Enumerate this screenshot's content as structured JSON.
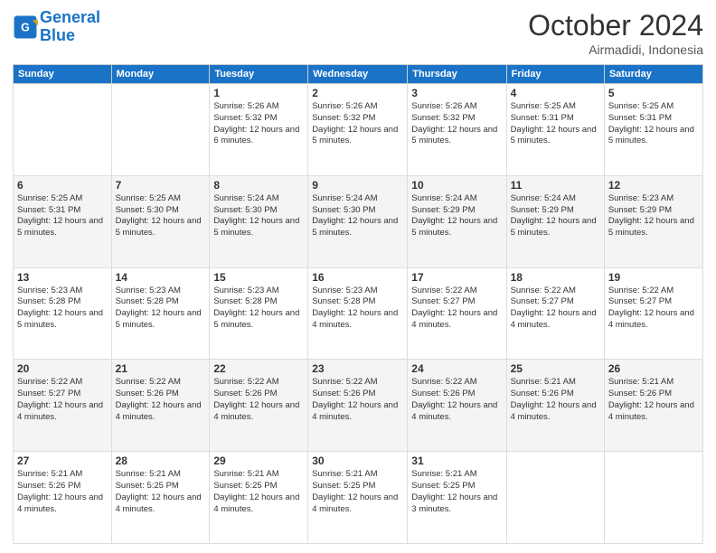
{
  "header": {
    "logo_line1": "General",
    "logo_line2": "Blue",
    "month": "October 2024",
    "location": "Airmadidi, Indonesia"
  },
  "weekdays": [
    "Sunday",
    "Monday",
    "Tuesday",
    "Wednesday",
    "Thursday",
    "Friday",
    "Saturday"
  ],
  "weeks": [
    [
      null,
      null,
      {
        "day": 1,
        "sunrise": "5:26 AM",
        "sunset": "5:32 PM",
        "daylight": "12 hours and 6 minutes."
      },
      {
        "day": 2,
        "sunrise": "5:26 AM",
        "sunset": "5:32 PM",
        "daylight": "12 hours and 5 minutes."
      },
      {
        "day": 3,
        "sunrise": "5:26 AM",
        "sunset": "5:32 PM",
        "daylight": "12 hours and 5 minutes."
      },
      {
        "day": 4,
        "sunrise": "5:25 AM",
        "sunset": "5:31 PM",
        "daylight": "12 hours and 5 minutes."
      },
      {
        "day": 5,
        "sunrise": "5:25 AM",
        "sunset": "5:31 PM",
        "daylight": "12 hours and 5 minutes."
      }
    ],
    [
      {
        "day": 6,
        "sunrise": "5:25 AM",
        "sunset": "5:31 PM",
        "daylight": "12 hours and 5 minutes."
      },
      {
        "day": 7,
        "sunrise": "5:25 AM",
        "sunset": "5:30 PM",
        "daylight": "12 hours and 5 minutes."
      },
      {
        "day": 8,
        "sunrise": "5:24 AM",
        "sunset": "5:30 PM",
        "daylight": "12 hours and 5 minutes."
      },
      {
        "day": 9,
        "sunrise": "5:24 AM",
        "sunset": "5:30 PM",
        "daylight": "12 hours and 5 minutes."
      },
      {
        "day": 10,
        "sunrise": "5:24 AM",
        "sunset": "5:29 PM",
        "daylight": "12 hours and 5 minutes."
      },
      {
        "day": 11,
        "sunrise": "5:24 AM",
        "sunset": "5:29 PM",
        "daylight": "12 hours and 5 minutes."
      },
      {
        "day": 12,
        "sunrise": "5:23 AM",
        "sunset": "5:29 PM",
        "daylight": "12 hours and 5 minutes."
      }
    ],
    [
      {
        "day": 13,
        "sunrise": "5:23 AM",
        "sunset": "5:28 PM",
        "daylight": "12 hours and 5 minutes."
      },
      {
        "day": 14,
        "sunrise": "5:23 AM",
        "sunset": "5:28 PM",
        "daylight": "12 hours and 5 minutes."
      },
      {
        "day": 15,
        "sunrise": "5:23 AM",
        "sunset": "5:28 PM",
        "daylight": "12 hours and 5 minutes."
      },
      {
        "day": 16,
        "sunrise": "5:23 AM",
        "sunset": "5:28 PM",
        "daylight": "12 hours and 4 minutes."
      },
      {
        "day": 17,
        "sunrise": "5:22 AM",
        "sunset": "5:27 PM",
        "daylight": "12 hours and 4 minutes."
      },
      {
        "day": 18,
        "sunrise": "5:22 AM",
        "sunset": "5:27 PM",
        "daylight": "12 hours and 4 minutes."
      },
      {
        "day": 19,
        "sunrise": "5:22 AM",
        "sunset": "5:27 PM",
        "daylight": "12 hours and 4 minutes."
      }
    ],
    [
      {
        "day": 20,
        "sunrise": "5:22 AM",
        "sunset": "5:27 PM",
        "daylight": "12 hours and 4 minutes."
      },
      {
        "day": 21,
        "sunrise": "5:22 AM",
        "sunset": "5:26 PM",
        "daylight": "12 hours and 4 minutes."
      },
      {
        "day": 22,
        "sunrise": "5:22 AM",
        "sunset": "5:26 PM",
        "daylight": "12 hours and 4 minutes."
      },
      {
        "day": 23,
        "sunrise": "5:22 AM",
        "sunset": "5:26 PM",
        "daylight": "12 hours and 4 minutes."
      },
      {
        "day": 24,
        "sunrise": "5:22 AM",
        "sunset": "5:26 PM",
        "daylight": "12 hours and 4 minutes."
      },
      {
        "day": 25,
        "sunrise": "5:21 AM",
        "sunset": "5:26 PM",
        "daylight": "12 hours and 4 minutes."
      },
      {
        "day": 26,
        "sunrise": "5:21 AM",
        "sunset": "5:26 PM",
        "daylight": "12 hours and 4 minutes."
      }
    ],
    [
      {
        "day": 27,
        "sunrise": "5:21 AM",
        "sunset": "5:26 PM",
        "daylight": "12 hours and 4 minutes."
      },
      {
        "day": 28,
        "sunrise": "5:21 AM",
        "sunset": "5:25 PM",
        "daylight": "12 hours and 4 minutes."
      },
      {
        "day": 29,
        "sunrise": "5:21 AM",
        "sunset": "5:25 PM",
        "daylight": "12 hours and 4 minutes."
      },
      {
        "day": 30,
        "sunrise": "5:21 AM",
        "sunset": "5:25 PM",
        "daylight": "12 hours and 4 minutes."
      },
      {
        "day": 31,
        "sunrise": "5:21 AM",
        "sunset": "5:25 PM",
        "daylight": "12 hours and 3 minutes."
      },
      null,
      null
    ]
  ]
}
